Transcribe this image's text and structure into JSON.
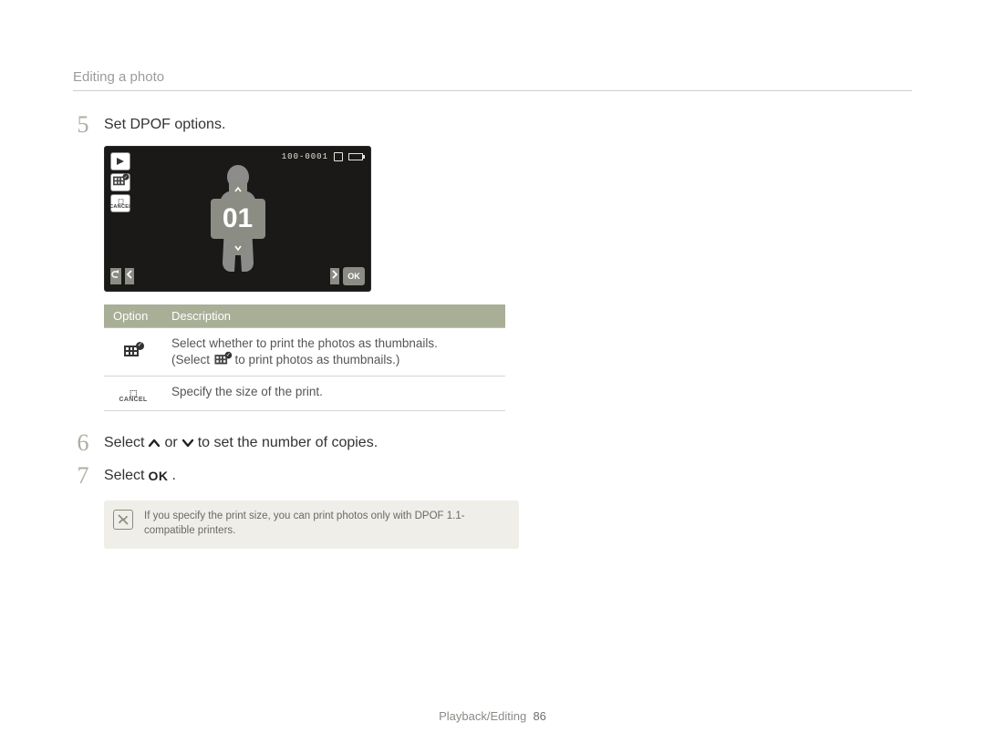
{
  "breadcrumb": "Editing a photo",
  "steps": {
    "s5": {
      "num": "5",
      "text": "Set DPOF options."
    },
    "s6": {
      "num": "6",
      "before": "Select ",
      "middle": " or ",
      "after": " to set the number of copies."
    },
    "s7": {
      "num": "7",
      "before": "Select ",
      "after": "."
    }
  },
  "lcd": {
    "file_no": "100-0001",
    "counter": "01",
    "ok_label": "OK"
  },
  "table": {
    "head_option": "Option",
    "head_desc": "Description",
    "row1_line1": "Select whether to print the photos as thumbnails.",
    "row1_line2_before": "(Select ",
    "row1_line2_after": " to print photos as thumbnails.)",
    "row2": "Specify the size of the print."
  },
  "note": {
    "text": "If you specify the print size, you can print photos only with DPOF 1.1-compatible printers."
  },
  "footer": {
    "section": "Playback/Editing",
    "page": "86"
  }
}
